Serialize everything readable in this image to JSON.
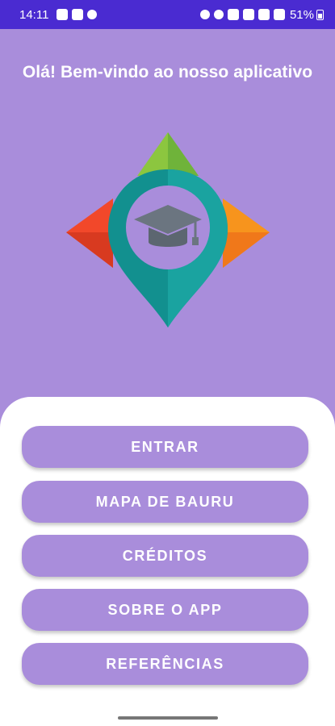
{
  "status_bar": {
    "time": "14:11",
    "battery": "51%",
    "left_icons": [
      "e-icon",
      "dnd-icon",
      "download-icon"
    ],
    "right_icons": [
      "alarm-icon",
      "alarm2-icon",
      "mute-icon",
      "wifi-icon",
      "volte-icon",
      "signal-icon"
    ]
  },
  "welcome": {
    "title": "Olá! Bem-vindo ao nosso aplicativo"
  },
  "logo": {
    "icon": "graduation-cap-location-pin-icon",
    "colors": [
      "#f2482a",
      "#f7941d",
      "#8cc63f",
      "#12908f",
      "#6b7580"
    ]
  },
  "menu": {
    "entrar": "ENTRAR",
    "mapa": "MAPA DE BAURU",
    "creditos": "CRÉDITOS",
    "sobre": "SOBRE O APP",
    "referencias": "REFERÊNCIAS"
  },
  "colors": {
    "background": "#a98ddb",
    "status_bar": "#4a2bd1",
    "panel": "#ffffff"
  }
}
